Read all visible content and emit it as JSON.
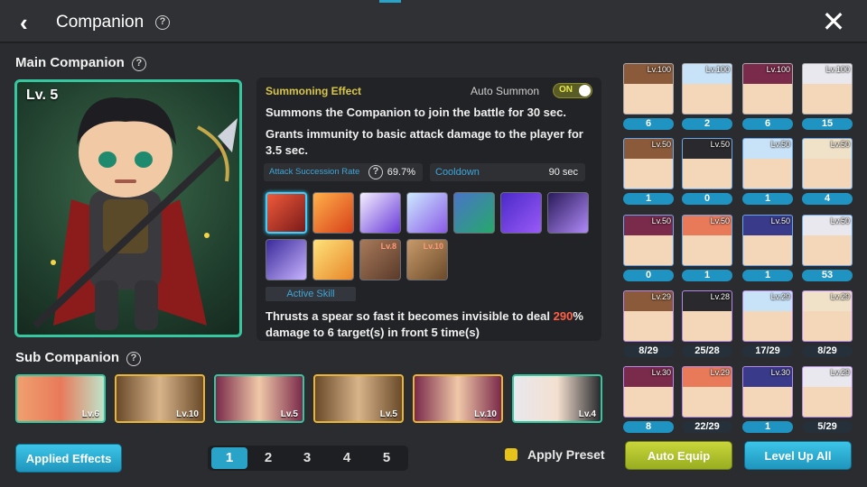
{
  "header": {
    "title": "Companion"
  },
  "main": {
    "label": "Main Companion",
    "level": "Lv. 5",
    "effect": {
      "title": "Summoning Effect",
      "auto_summon_label": "Auto Summon",
      "toggle": "ON",
      "line1": "Summons the Companion to join the battle for 30 sec.",
      "line2": "Grants immunity to basic attack damage to the player for 3.5 sec.",
      "attack_label": "Attack Succession Rate",
      "attack_value": "69.7%",
      "cooldown_label": "Cooldown",
      "cooldown_value": "90 sec",
      "skill_levels": [
        "Lv.8",
        "Lv.10"
      ],
      "active_label": "Active Skill",
      "desc_pre": "Thrusts a spear so fast it becomes invisible to deal ",
      "desc_hl": "290",
      "desc_post": "% damage to 6 target(s) in front 5 time(s)"
    }
  },
  "sub": {
    "label": "Sub Companion",
    "levels": [
      "Lv.6",
      "Lv.10",
      "Lv.5",
      "Lv.5",
      "Lv.10",
      "Lv.4"
    ]
  },
  "footer": {
    "applied_effects": "Applied Effects",
    "pages": [
      "1",
      "2",
      "3",
      "4",
      "5"
    ],
    "apply_preset": "Apply Preset",
    "auto_equip": "Auto Equip",
    "level_up_all": "Level Up All"
  },
  "grid": {
    "levels": [
      [
        "Lv.100",
        "Lv.100",
        "Lv.100",
        "Lv.100"
      ],
      [
        "Lv.50",
        "Lv.50",
        "Lv.50",
        "Lv.50"
      ],
      [
        "Lv.50",
        "Lv.50",
        "Lv.50",
        "Lv.50"
      ],
      [
        "Lv.29",
        "Lv.28",
        "Lv.29",
        "Lv.29"
      ],
      [
        "Lv.30",
        "Lv.29",
        "Lv.30",
        "Lv.29"
      ]
    ],
    "counts": [
      [
        "6",
        "2",
        "6",
        "15"
      ],
      [
        "1",
        "0",
        "1",
        "4"
      ],
      [
        "0",
        "1",
        "1",
        "53"
      ],
      [
        "8/29",
        "25/28",
        "17/29",
        "8/29"
      ],
      [
        "8",
        "22/29",
        "1",
        "5/29"
      ]
    ]
  },
  "colors": {
    "accent": "#2aa3c8",
    "highlight": "#ff5f45",
    "gold": "#d8c64a"
  }
}
